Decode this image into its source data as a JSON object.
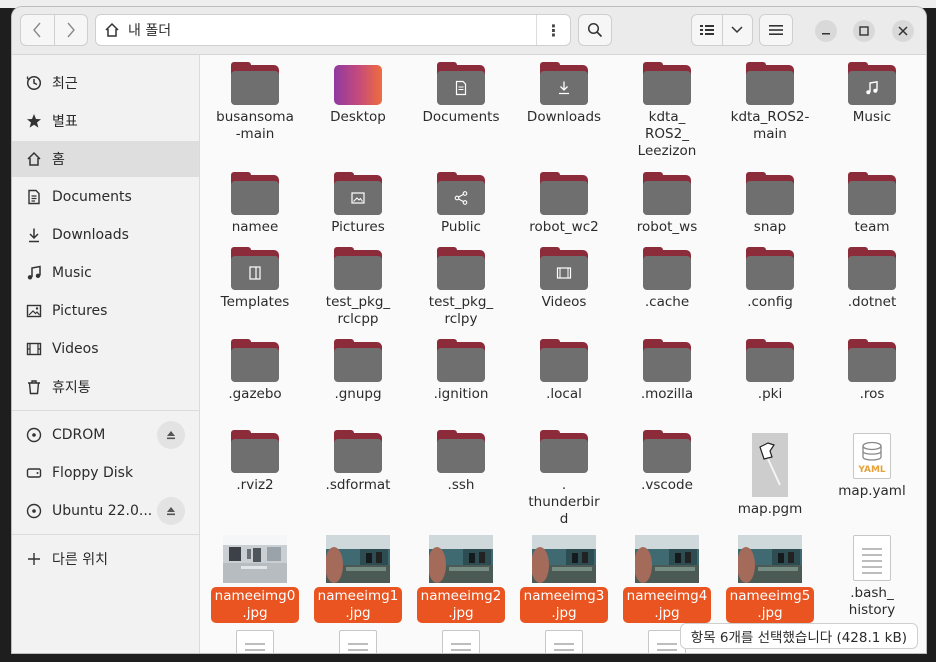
{
  "window": {
    "location": "내 폴더"
  },
  "sidebar": {
    "items": [
      {
        "label": "최근",
        "icon": "clock-icon"
      },
      {
        "label": "별표",
        "icon": "star-icon"
      },
      {
        "label": "홈",
        "icon": "home-icon",
        "active": true
      },
      {
        "label": "Documents",
        "icon": "document-icon"
      },
      {
        "label": "Downloads",
        "icon": "download-icon"
      },
      {
        "label": "Music",
        "icon": "music-icon"
      },
      {
        "label": "Pictures",
        "icon": "picture-icon"
      },
      {
        "label": "Videos",
        "icon": "video-icon"
      },
      {
        "label": "휴지통",
        "icon": "trash-icon"
      }
    ],
    "devices": [
      {
        "label": "CDROM",
        "icon": "disc-icon",
        "eject": true
      },
      {
        "label": "Floppy Disk",
        "icon": "drive-icon",
        "eject": false
      },
      {
        "label": "Ubuntu 22.0...",
        "icon": "disc-icon",
        "eject": true
      }
    ],
    "other": {
      "label": "다른 위치",
      "icon": "plus-icon"
    }
  },
  "files": [
    {
      "name": "busansoma\n-main",
      "kind": "folder"
    },
    {
      "name": "Desktop",
      "kind": "desktop"
    },
    {
      "name": "Documents",
      "kind": "folder",
      "emblem": "document"
    },
    {
      "name": "Downloads",
      "kind": "folder",
      "emblem": "download"
    },
    {
      "name": "kdta_\nROS2_\nLeezizon",
      "kind": "folder"
    },
    {
      "name": "kdta_ROS2-\nmain",
      "kind": "folder"
    },
    {
      "name": "Music",
      "kind": "folder",
      "emblem": "music"
    },
    {
      "name": "namee",
      "kind": "folder"
    },
    {
      "name": "Pictures",
      "kind": "folder",
      "emblem": "picture"
    },
    {
      "name": "Public",
      "kind": "folder",
      "emblem": "share"
    },
    {
      "name": "robot_wc2",
      "kind": "folder"
    },
    {
      "name": "robot_ws",
      "kind": "folder"
    },
    {
      "name": "snap",
      "kind": "folder"
    },
    {
      "name": "team",
      "kind": "folder"
    },
    {
      "name": "Templates",
      "kind": "folder",
      "emblem": "template"
    },
    {
      "name": "test_pkg_\nrclcpp",
      "kind": "folder"
    },
    {
      "name": "test_pkg_\nrclpy",
      "kind": "folder"
    },
    {
      "name": "Videos",
      "kind": "folder",
      "emblem": "video"
    },
    {
      "name": ".cache",
      "kind": "folder"
    },
    {
      "name": ".config",
      "kind": "folder"
    },
    {
      "name": ".dotnet",
      "kind": "folder"
    },
    {
      "name": ".gazebo",
      "kind": "folder"
    },
    {
      "name": ".gnupg",
      "kind": "folder"
    },
    {
      "name": ".ignition",
      "kind": "folder"
    },
    {
      "name": ".local",
      "kind": "folder"
    },
    {
      "name": ".mozilla",
      "kind": "folder"
    },
    {
      "name": ".pki",
      "kind": "folder"
    },
    {
      "name": ".ros",
      "kind": "folder"
    },
    {
      "name": ".rviz2",
      "kind": "folder"
    },
    {
      "name": ".sdformat",
      "kind": "folder"
    },
    {
      "name": ".ssh",
      "kind": "folder"
    },
    {
      "name": ".\nthunderbir\nd",
      "kind": "folder"
    },
    {
      "name": ".vscode",
      "kind": "folder"
    },
    {
      "name": "map.pgm",
      "kind": "pgm"
    },
    {
      "name": "map.yaml",
      "kind": "yaml"
    },
    {
      "name": "nameeimg0\n.jpg",
      "kind": "photo",
      "selected": true,
      "photo": "hall"
    },
    {
      "name": "nameeimg1\n.jpg",
      "kind": "photo",
      "selected": true,
      "photo": "lab"
    },
    {
      "name": "nameeimg2\n.jpg",
      "kind": "photo",
      "selected": true,
      "photo": "lab"
    },
    {
      "name": "nameeimg3\n.jpg",
      "kind": "photo",
      "selected": true,
      "photo": "lab"
    },
    {
      "name": "nameeimg4\n.jpg",
      "kind": "photo",
      "selected": true,
      "photo": "lab"
    },
    {
      "name": "nameeimg5\n.jpg",
      "kind": "photo",
      "selected": true,
      "photo": "lab"
    },
    {
      "name": ".bash_\nhistory",
      "kind": "text"
    },
    {
      "name": "",
      "kind": "text"
    },
    {
      "name": "",
      "kind": "text"
    },
    {
      "name": "",
      "kind": "text"
    },
    {
      "name": "",
      "kind": "text"
    },
    {
      "name": "",
      "kind": "text"
    }
  ],
  "status": {
    "text": "항목 6개를 선택했습니다 (428.1 kB)"
  },
  "colors": {
    "accent": "#e95420",
    "folder_tab": "#8c2b3a",
    "folder_body": "#6f6f6f"
  }
}
